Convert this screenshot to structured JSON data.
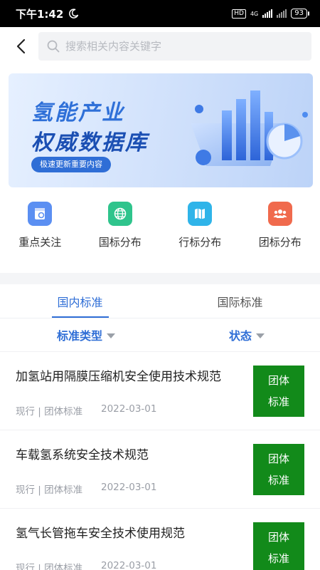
{
  "status_bar": {
    "time": "下午1:42",
    "network_label": "HD",
    "network_type": "4G",
    "battery": "93"
  },
  "header": {
    "search_placeholder": "搜索相关内容关键字"
  },
  "banner": {
    "title_line1": "氢能产业",
    "title_line2": "权威数据库",
    "subtitle": "极速更新重要内容"
  },
  "shortcuts": [
    {
      "label": "重点关注",
      "icon": "star-doc-icon",
      "color": "#5b8ff2"
    },
    {
      "label": "国标分布",
      "icon": "globe-icon",
      "color": "#2fc48c"
    },
    {
      "label": "行标分布",
      "icon": "map-icon",
      "color": "#2fb4e9"
    },
    {
      "label": "团标分布",
      "icon": "group-icon",
      "color": "#f06a4d"
    }
  ],
  "tabs": [
    {
      "label": "国内标准",
      "active": true
    },
    {
      "label": "国际标准",
      "active": false
    }
  ],
  "filters": {
    "type_label": "标准类型",
    "status_label": "状态"
  },
  "colors": {
    "accent": "#2f6ed6",
    "badge_green": "#128a1a"
  },
  "standards": [
    {
      "title": "加氢站用隔膜压缩机安全使用技术规范",
      "meta": "现行 | 团体标准",
      "date": "2022-03-01",
      "badge_line1": "团体",
      "badge_line2": "标准"
    },
    {
      "title": "车载氢系统安全技术规范",
      "meta": "现行 | 团体标准",
      "date": "2022-03-01",
      "badge_line1": "团体",
      "badge_line2": "标准"
    },
    {
      "title": "氢气长管拖车安全技术使用规范",
      "meta": "现行 | 团体标准",
      "date": "2022-03-01",
      "badge_line1": "团体",
      "badge_line2": "标准"
    }
  ]
}
